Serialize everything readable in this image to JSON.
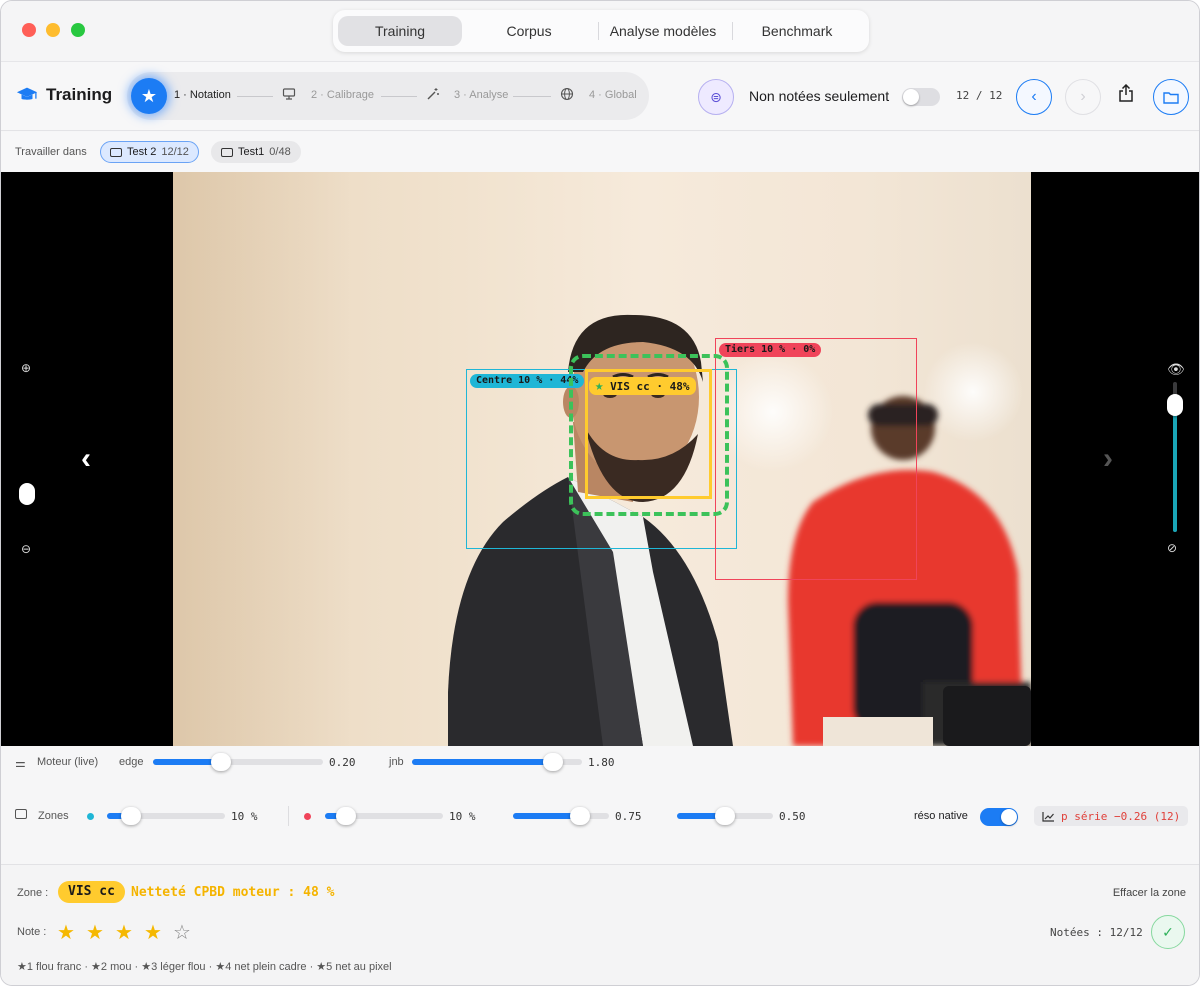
{
  "nav": {
    "tabs": [
      {
        "label": "Training",
        "active": true
      },
      {
        "label": "Corpus",
        "active": false
      },
      {
        "label": "Analyse modèles",
        "active": false
      },
      {
        "label": "Benchmark",
        "active": false
      }
    ]
  },
  "toolbar": {
    "brand": "Training",
    "steps": [
      {
        "label": "1 · Notation",
        "icon": "star-icon",
        "active": true
      },
      {
        "label": "2 · Calibrage",
        "icon": "monitor-icon",
        "active": false
      },
      {
        "label": "3 · Analyse",
        "icon": "wand-icon",
        "active": false
      },
      {
        "label": "4 · Global",
        "icon": "globe-icon",
        "active": false
      }
    ],
    "filter_label": "Non notées seulement",
    "filter_on": false,
    "counter": "12 / 12"
  },
  "workspace": {
    "label": "Travailler dans",
    "folders": [
      {
        "name": "Test 2",
        "count": "12/12",
        "active": true
      },
      {
        "name": "Test1",
        "count": "0/48",
        "active": false
      }
    ]
  },
  "viewer": {
    "zones": [
      {
        "label": "Centre 10 % · 44%",
        "color": "#1fb6d6"
      },
      {
        "label": "Tiers 10 % · 0%",
        "color": "#f0445a"
      },
      {
        "label": "VIS cc · 48%",
        "color": "#ffcb2e"
      }
    ],
    "zoom_level": 0.2,
    "overlay_opacity": 0.85
  },
  "controls": {
    "engine": {
      "label": "Moteur (live)",
      "sliders": [
        {
          "name": "edge",
          "value": "0.20",
          "fraction": 0.4
        },
        {
          "name": "jnb",
          "value": "1.80",
          "fraction": 0.83
        }
      ]
    },
    "zones": {
      "label": "Zones",
      "sliders": [
        {
          "value": "10 %",
          "fraction": 0.2,
          "dot": "#1fb6d6"
        },
        {
          "value": "10 %",
          "fraction": 0.18,
          "dot": "#f0445a"
        },
        {
          "value": "0.75",
          "fraction": 0.7
        },
        {
          "value": "0.50",
          "fraction": 0.5
        }
      ],
      "native_label": "réso native",
      "native_on": true,
      "series": "p série −0.26 (12)"
    }
  },
  "bottom": {
    "zone_label": "Zone :",
    "zone_name": "VIS cc",
    "sharpness": "Netteté CPBD moteur : 48 %",
    "clear_label": "Effacer la zone",
    "note_label": "Note :",
    "rating": 4,
    "max_rating": 5,
    "rated": "Notées : 12/12",
    "legend": "★1 flou franc · ★2 mou · ★3 léger flou · ★4 net plein cadre · ★5 net au pixel"
  }
}
